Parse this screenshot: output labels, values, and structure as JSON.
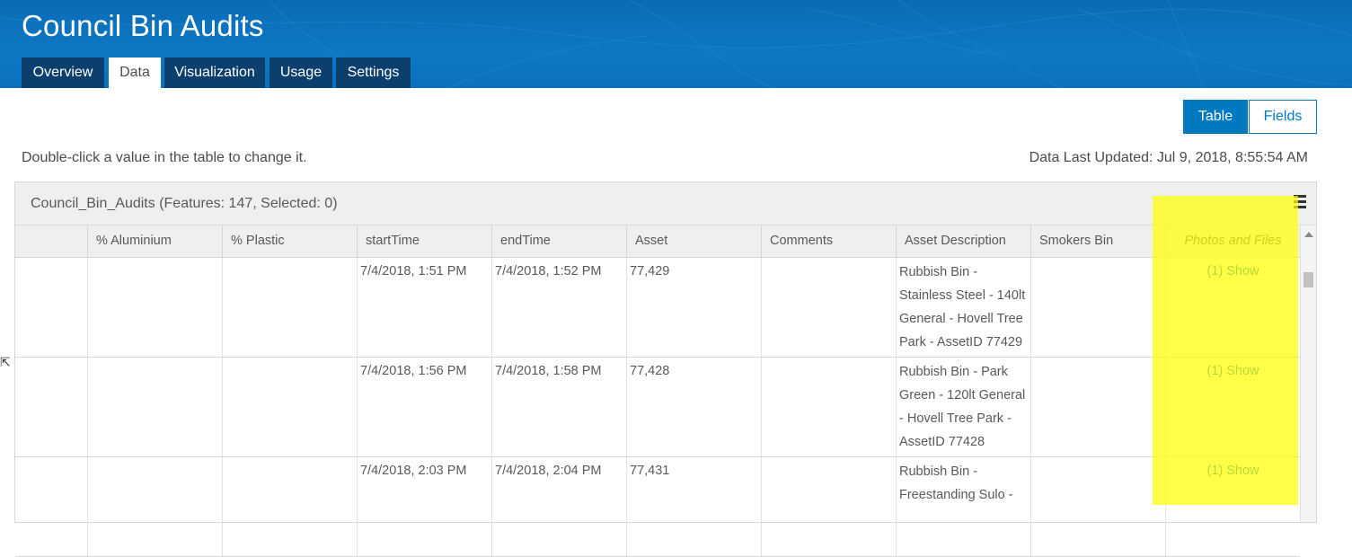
{
  "app": {
    "title": "Council Bin Audits",
    "tabs": [
      {
        "label": "Overview",
        "active": false
      },
      {
        "label": "Data",
        "active": true
      },
      {
        "label": "Visualization",
        "active": false
      },
      {
        "label": "Usage",
        "active": false
      },
      {
        "label": "Settings",
        "active": false
      }
    ]
  },
  "view_toggle": {
    "table_label": "Table",
    "fields_label": "Fields",
    "selected": "Table"
  },
  "hint_text": "Double-click a value in the table to change it.",
  "last_updated": "Data Last Updated: Jul 9, 2018, 8:55:54 AM",
  "table": {
    "layer_title": "Council_Bin_Audits (Features: 147, Selected: 0)",
    "columns": [
      "",
      "% Aluminium",
      "% Plastic",
      "startTime",
      "endTime",
      "Asset",
      "Comments",
      "Asset Description",
      "Smokers Bin",
      "Photos and Files"
    ],
    "rows": [
      {
        "cells": [
          "",
          "",
          "",
          "7/4/2018, 1:51 PM",
          "7/4/2018, 1:52 PM",
          "77,429",
          "",
          "Rubbish Bin - Stainless Steel - 140lt General - Hovell Tree Park - AssetID 77429",
          "",
          "(1) Show"
        ]
      },
      {
        "cells": [
          "",
          "",
          "",
          "7/4/2018, 1:56 PM",
          "7/4/2018, 1:58 PM",
          "77,428",
          "",
          "Rubbish Bin - Park Green - 120lt General - Hovell Tree Park - AssetID 77428",
          "",
          "(1) Show"
        ]
      },
      {
        "cells": [
          "",
          "",
          "",
          "7/4/2018, 2:03 PM",
          "7/4/2018, 2:04 PM",
          "77,431",
          "",
          "Rubbish Bin - Freestanding Sulo -",
          "",
          "(1) Show"
        ]
      }
    ]
  },
  "icons": {
    "menu": "hamburger-menu-icon",
    "cursor": "pointer-cursor-icon"
  },
  "colors": {
    "banner": "#0d78c4",
    "tab_dark": "#0b3f6e",
    "accent": "#0079c1",
    "highlight": "#ffff00"
  }
}
